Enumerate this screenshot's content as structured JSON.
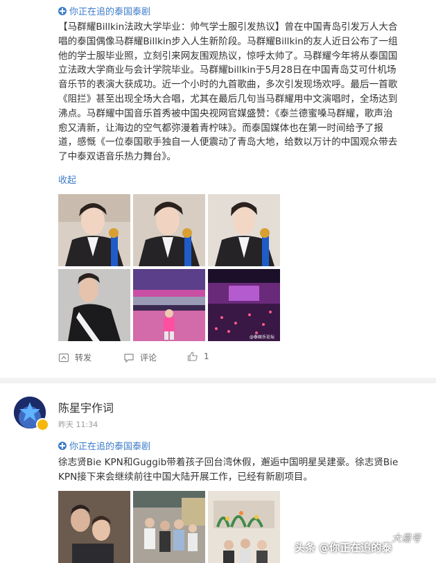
{
  "post1": {
    "topic": "你正在追的泰国泰剧",
    "text_lines": [
      "【马群耀Billkin法政大学毕业：帅气学士服引发热议】曾在中国青岛引发万人大合",
      "唱的泰国偶像马群耀Billkin步入人生新阶段。马群耀Billkin的友人近日公布了一组",
      "他的学士服毕业照，立刻引来网友围观热议，惊呼太帅了。马群耀今年将从泰国国",
      "立法政大学商业与会计学院毕业。马群耀billkin于5月28日在中国青岛艾可什机场",
      "音乐节的表演大获成功。近一个小时的九首歌曲，多次引发现场欢呼。最后一首歌",
      "《阻拦》甚至出现全场大合唱，尤其在最后几句当马群耀用中文演唱时，全场达到",
      "沸点。马群耀中国音乐首秀被中国央视网官媒盛赞：《泰兰德蜜嗓马群耀，歌声治",
      "愈又清新，让海边的空气都弥漫着青柠味》。而泰国媒体也在第一时间给予了报",
      "道，感慨《一位泰国歌手独自一人便震动了青岛大地，给数以万计的中国观众带去",
      "了中泰双语音乐热力舞台》。"
    ],
    "collapse": "收起",
    "photo_caption": "@泰娱乐论坛",
    "actions": {
      "repost": "转发",
      "comment": "评论",
      "like": "1"
    }
  },
  "post2": {
    "username": "陈星宇作词",
    "time": "昨天 11:34",
    "topic": "你正在追的泰国泰剧",
    "text_lines": [
      "徐志贤Bie KPN和Guggib带着孩子回台湾休假，邂逅中国明星吴建豪。徐志贤Bie",
      "KPN接下来会继续前往中国大陆开展工作，已经有新剧项目。"
    ]
  },
  "watermark": "头条 @你正在追的泰",
  "watermark_corner": "大易号"
}
